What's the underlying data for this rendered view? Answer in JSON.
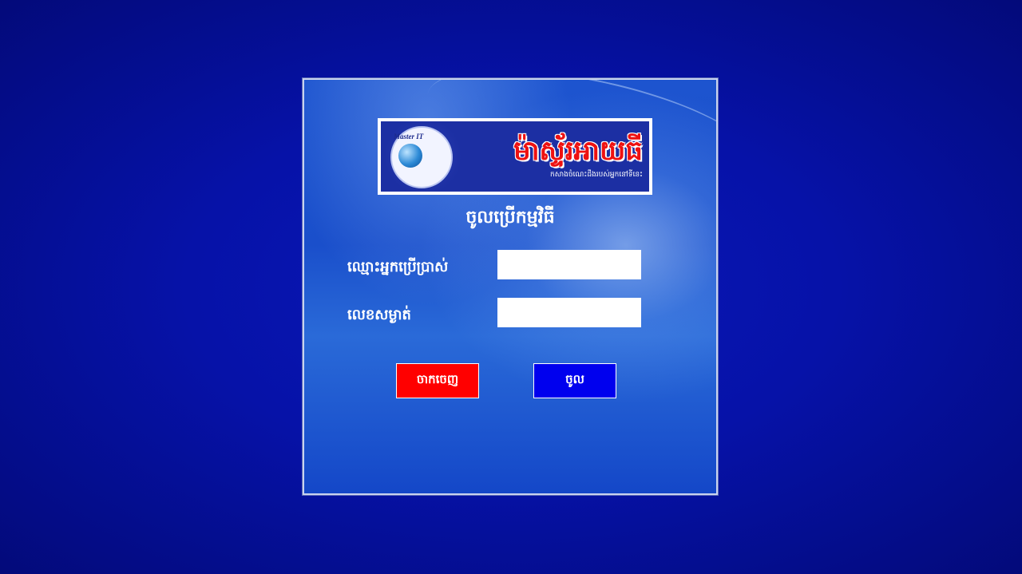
{
  "logo": {
    "emblem_text": "Master IT",
    "emblem_small": "Master IT",
    "title": "ម៉ាស្ទ័រអាយធី",
    "subtitle": "កសាងចំណេះដឹងរបស់អ្នកនៅទីនេះ"
  },
  "login": {
    "heading": "ចូលប្រើកម្មវិធី",
    "username_label": "ឈ្មោះអ្នកប្រើប្រាស់",
    "username_value": "",
    "password_label": "លេខសម្ងាត់",
    "password_value": "",
    "exit_label": "ចាកចេញ",
    "login_label": "ចូល"
  },
  "colors": {
    "background": "#0612a8",
    "panel": "#1a4fcb",
    "exit_button": "#ff0000",
    "login_button": "#0000ee"
  }
}
